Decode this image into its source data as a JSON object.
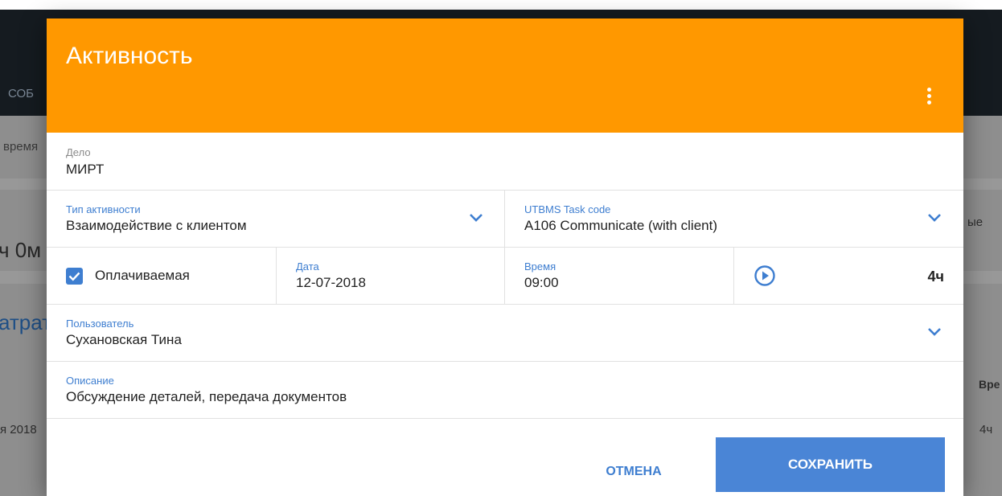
{
  "background": {
    "nav_fragment": "СОБ",
    "subnav_fragment": "время",
    "right_fragment": "ые",
    "duration_fragment": "ч 0м",
    "section_fragment": "атрат",
    "column_fragment": "Вре",
    "row_date_fragment": "я 2018",
    "row_time_fragment": "4ч"
  },
  "dialog": {
    "title": "Активность",
    "case": {
      "label": "Дело",
      "value": "МИРТ"
    },
    "activity_type": {
      "label": "Тип активности",
      "value": "Взаимодействие с клиентом"
    },
    "utbms": {
      "label": "UTBMS Task code",
      "value": "A106 Communicate (with client)"
    },
    "billable": {
      "label": "Оплачиваемая",
      "checked": true
    },
    "date": {
      "label": "Дата",
      "value": "12-07-2018"
    },
    "time": {
      "label": "Время",
      "value": "09:00"
    },
    "duration": "4ч",
    "user": {
      "label": "Пользователь",
      "value": "Сухановская Тина"
    },
    "description": {
      "label": "Описание",
      "value": "Обсуждение деталей, передача документов"
    },
    "cancel_label": "ОТМЕНА",
    "save_label": "СОХРАНИТЬ"
  },
  "colors": {
    "header": "#ff9800",
    "accent": "#3e7ed0",
    "save_button": "#4a85d6"
  },
  "icons": [
    "more-vert-icon",
    "chevron-down-icon",
    "check-icon",
    "play-circle-icon"
  ]
}
